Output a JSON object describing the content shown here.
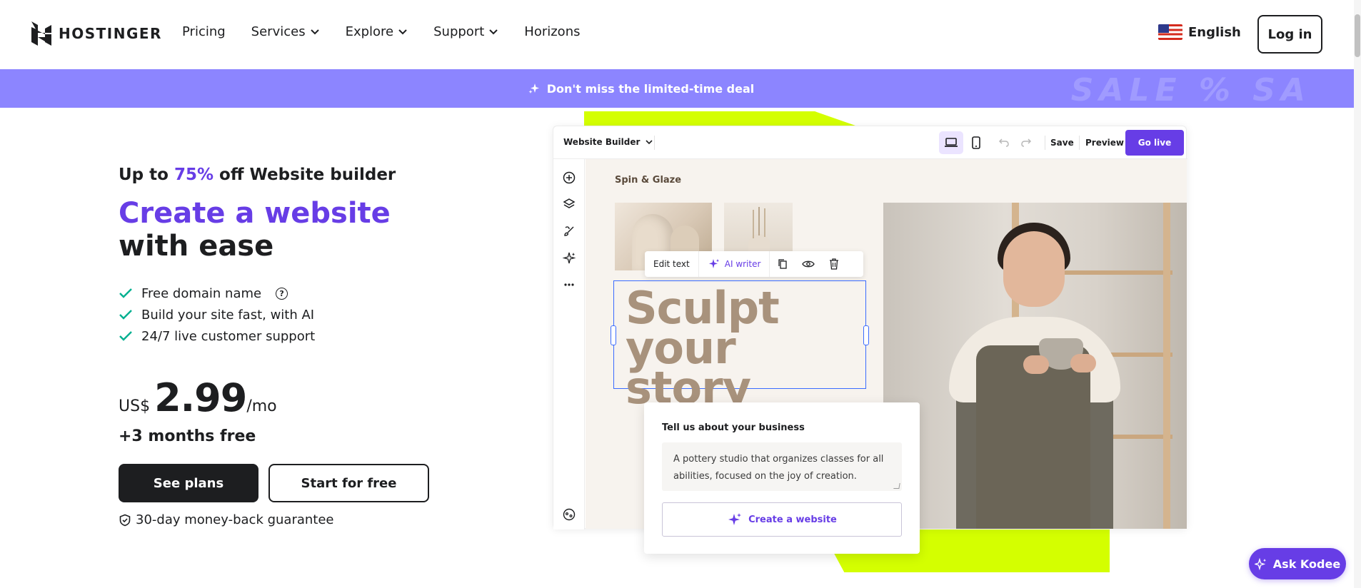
{
  "header": {
    "logo_text": "HOSTINGER",
    "nav": [
      {
        "label": "Pricing",
        "has_dropdown": false
      },
      {
        "label": "Services",
        "has_dropdown": true
      },
      {
        "label": "Explore",
        "has_dropdown": true
      },
      {
        "label": "Support",
        "has_dropdown": true
      },
      {
        "label": "Horizons",
        "has_dropdown": false
      }
    ],
    "language": "English",
    "login_label": "Log in"
  },
  "promo": {
    "text": "Don't miss the limited-time deal",
    "decor": "SALE  %  SA"
  },
  "hero": {
    "discount_prefix": "Up to ",
    "discount_value": "75%",
    "discount_suffix": " off Website builder",
    "title_accent": "Create a website",
    "title_rest": " with ease",
    "features": [
      "Free domain name",
      "Build your site fast, with AI",
      "24/7 live customer support"
    ],
    "currency": "US$",
    "price": "2.99",
    "period": "/mo",
    "bonus": "+3 months free",
    "primary_cta": "See plans",
    "secondary_cta": "Start for free",
    "guarantee": "30-day money-back guarantee"
  },
  "builder": {
    "title": "Website Builder",
    "save": "Save",
    "preview": "Preview",
    "go_live": "Go live",
    "brand": "Spin & Glaze",
    "edit_text": "Edit text",
    "ai_writer": "AI writer",
    "headline_1": "Sculpt",
    "headline_2": "your story",
    "ai_card": {
      "label": "Tell us about your business",
      "text": "A pottery studio that organizes classes for all abilities, focused on the joy of creation.",
      "button": "Create a website"
    }
  },
  "chat": {
    "label": "Ask Kodee"
  },
  "colors": {
    "accent": "#673de6",
    "promo": "#8c85ff",
    "lime": "#d4ff00",
    "check": "#00b090",
    "dark": "#1d1e20"
  },
  "icons": {
    "logo": "hostinger-logo-icon",
    "dropdown": "chevron-down-icon",
    "flag": "us-flag-icon",
    "sparkle": "sparkle-icon",
    "check": "check-icon",
    "help": "help-icon",
    "shield": "shield-check-icon"
  }
}
